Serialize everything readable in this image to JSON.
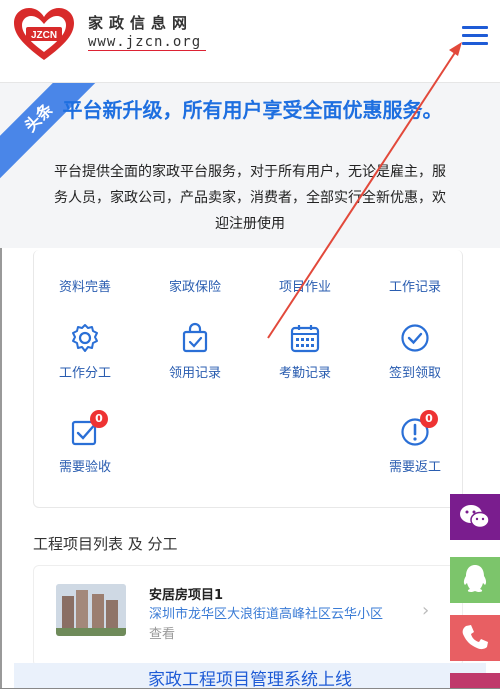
{
  "header": {
    "logo_badge": "JZCN",
    "site_name": "家政信息网",
    "site_url": "www.jzcn.org"
  },
  "banner": {
    "tag": "头条",
    "title": "平台新升级，所有用户享受全面优惠服务。",
    "description": "平台提供全面的家政平台服务，对于所有用户，无论是雇主，服务人员，家政公司，产品卖家，消费者，全部实行全新优惠，欢迎注册使用"
  },
  "features": {
    "row1": [
      "资料完善",
      "家政保险",
      "项目作业",
      "工作记录"
    ],
    "row2": [
      {
        "label": "工作分工",
        "icon": "gear-icon"
      },
      {
        "label": "领用记录",
        "icon": "bag-check-icon"
      },
      {
        "label": "考勤记录",
        "icon": "calendar-icon"
      },
      {
        "label": "签到领取",
        "icon": "check-circle-icon"
      }
    ],
    "row3": [
      {
        "label": "需要验收",
        "icon": "checkbox-icon",
        "badge": "0"
      },
      {
        "label": "需要返工",
        "icon": "alert-circle-icon",
        "badge": "0"
      }
    ]
  },
  "projects": {
    "section_title": "工程项目列表 及 分工",
    "items": [
      {
        "name": "安居房项目1",
        "address": "深圳市龙华区大浪街道高峰社区云华小区",
        "action": "查看"
      }
    ]
  },
  "footer": {
    "notice": "家政工程项目管理系统上线"
  },
  "colors": {
    "accent": "#1e5bd6",
    "title_blue": "#1e6fe0",
    "badge_red": "#e33333",
    "wechat": "#7a1d8e",
    "qq": "#7cc56b",
    "phone": "#e85f63"
  }
}
